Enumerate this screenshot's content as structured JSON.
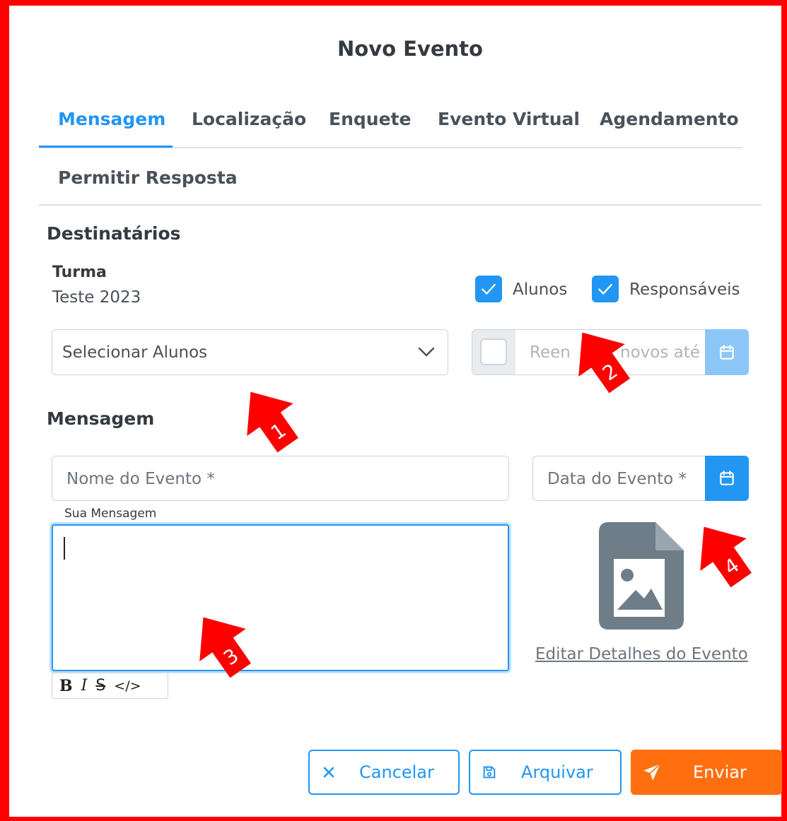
{
  "dialog": {
    "title": "Novo Evento"
  },
  "tabs": [
    {
      "label": "Mensagem",
      "active": true
    },
    {
      "label": "Localização"
    },
    {
      "label": "Enquete"
    },
    {
      "label": "Evento Virtual"
    },
    {
      "label": "Agendamento"
    },
    {
      "label": "Permitir Resposta"
    }
  ],
  "recipients": {
    "section_title": "Destinatários",
    "class_label": "Turma",
    "class_value": "Teste 2023",
    "checkbox_students": {
      "label": "Alunos",
      "checked": true
    },
    "checkbox_guardians": {
      "label": "Responsáveis",
      "checked": true
    },
    "select_students_placeholder": "Selecionar Alunos",
    "resend_checked": false,
    "resend_placeholder_left": "Reen",
    "resend_placeholder_right": "novos até"
  },
  "message": {
    "section_title": "Mensagem",
    "event_name_placeholder": "Nome do Evento  *",
    "event_date_placeholder": "Data do Evento  *",
    "editor_label": "Sua Mensagem",
    "editor_value": "",
    "toolbar": {
      "bold": "B",
      "italic": "I",
      "strike": "S",
      "code": "</>"
    },
    "edit_details_link": "Editar Detalhes do Evento"
  },
  "actions": {
    "cancel": "Cancelar",
    "archive": "Arquivar",
    "send": "Enviar"
  },
  "annotations": [
    "1",
    "2",
    "3",
    "4"
  ],
  "colors": {
    "accent": "#2196f3",
    "send": "#ff6f10",
    "annotation": "#ff0000",
    "frame": "#ff0000"
  }
}
